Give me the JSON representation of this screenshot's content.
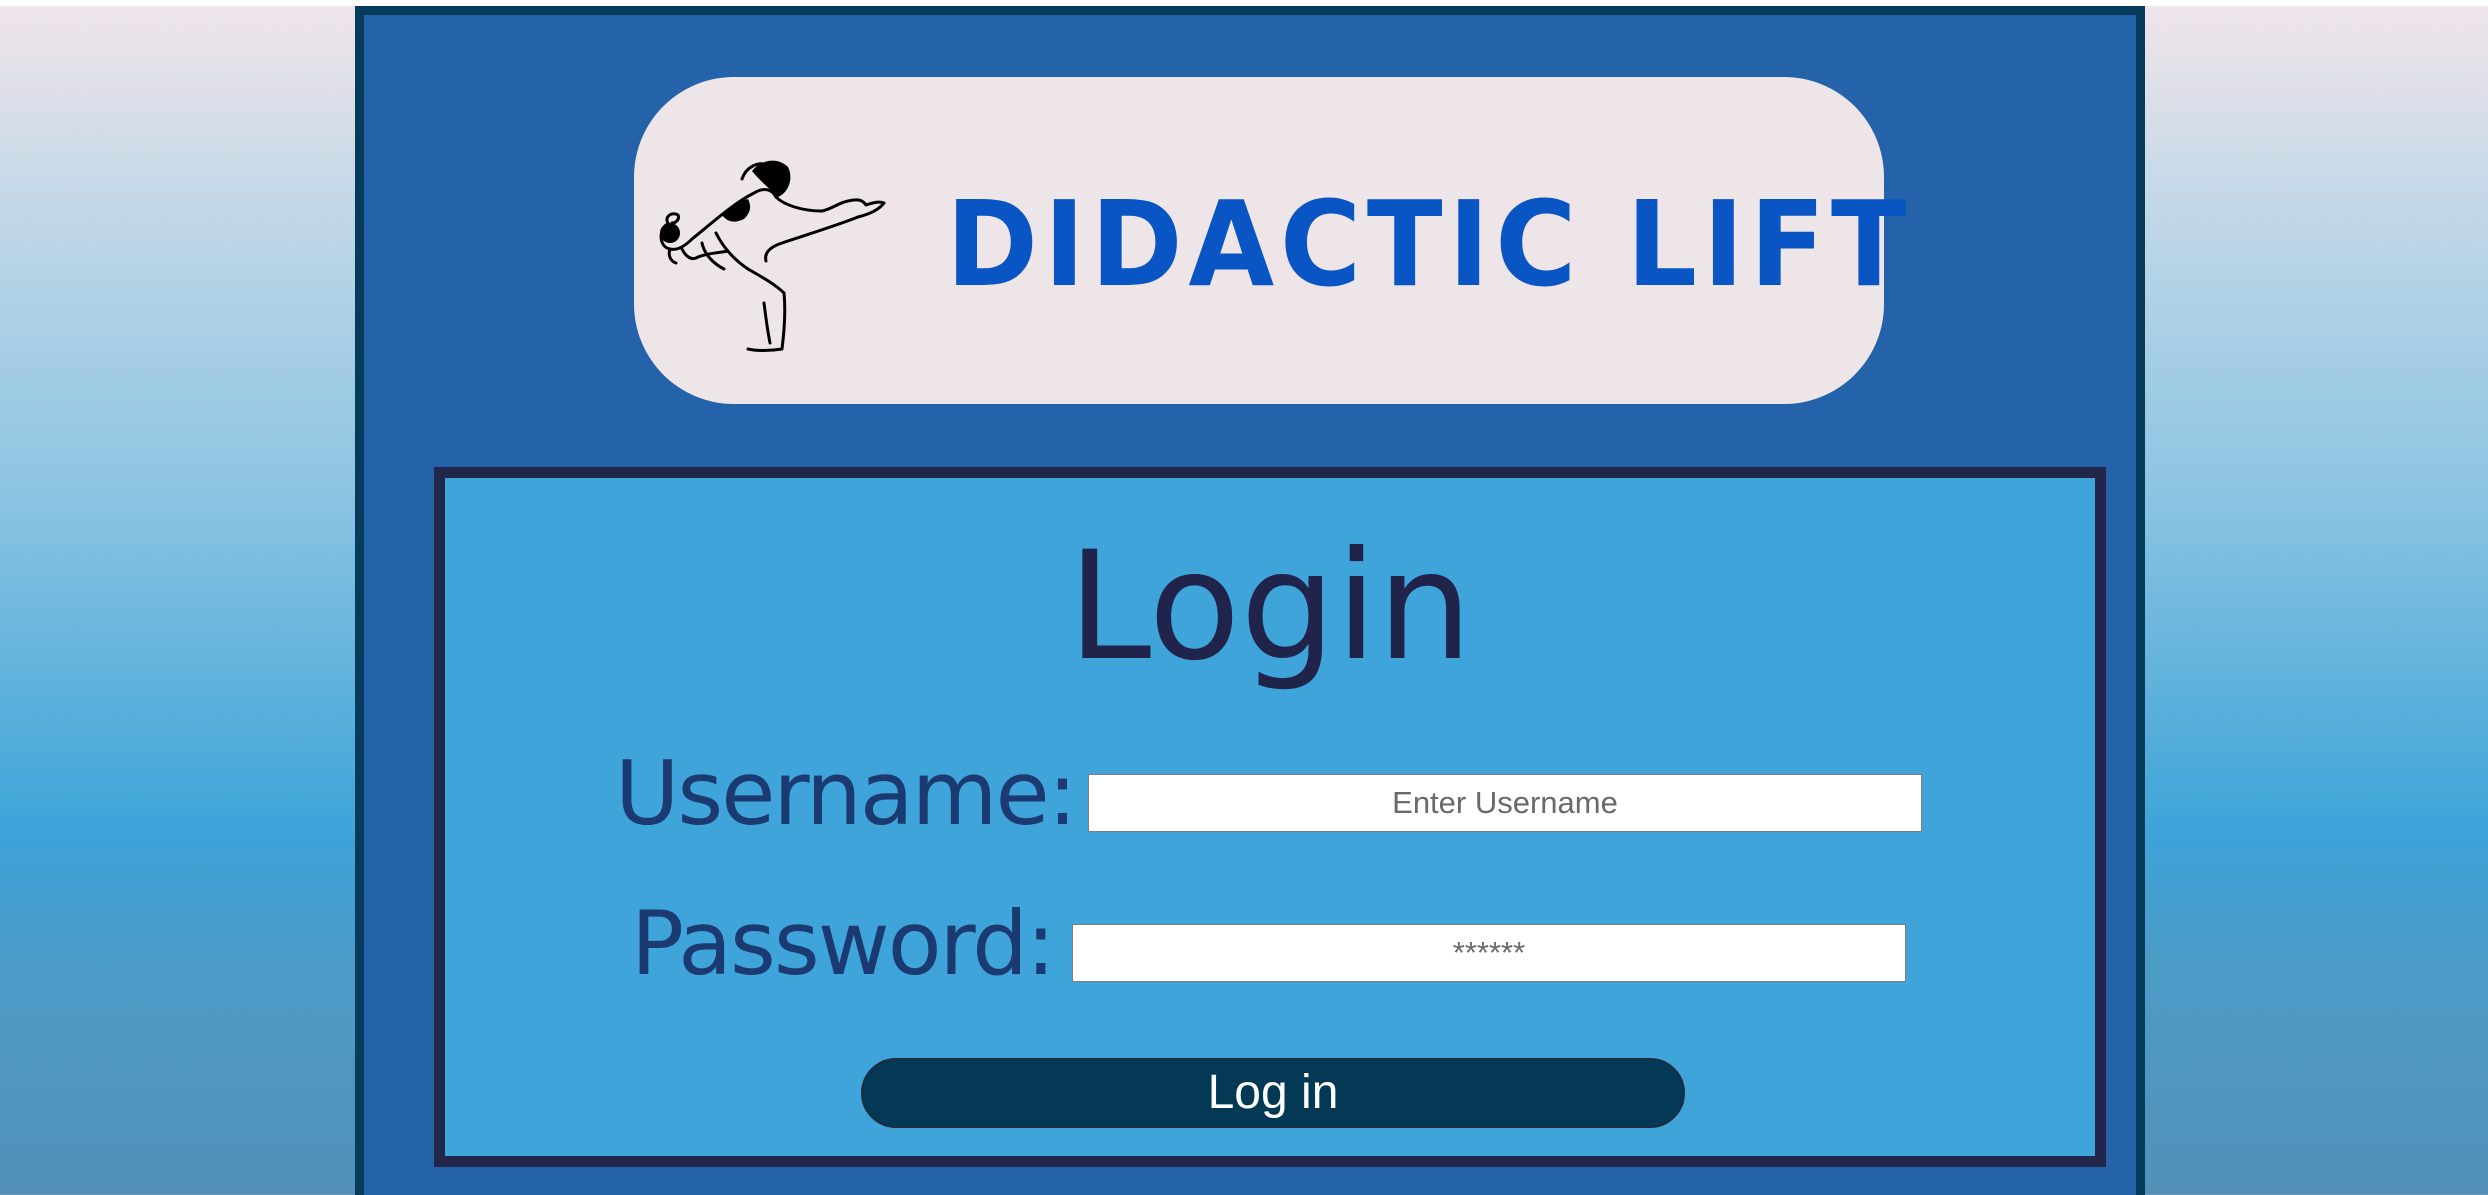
{
  "logo": {
    "brand_text": "DIDACTIC LIFT",
    "figure_icon": "yoga-crow-pose-figure",
    "text_color": "#0a55c4"
  },
  "login": {
    "title": "Login",
    "username": {
      "label": "Username:",
      "placeholder": "Enter Username"
    },
    "password": {
      "label": "Password:",
      "placeholder": "******"
    },
    "submit_label": "Log in"
  },
  "colors": {
    "panel": "#2463aa",
    "panel_border": "#063b5c",
    "login_box": "#3ea4da",
    "login_box_border": "#22264a",
    "button": "#033954",
    "logo_background": "#eee5e9"
  }
}
